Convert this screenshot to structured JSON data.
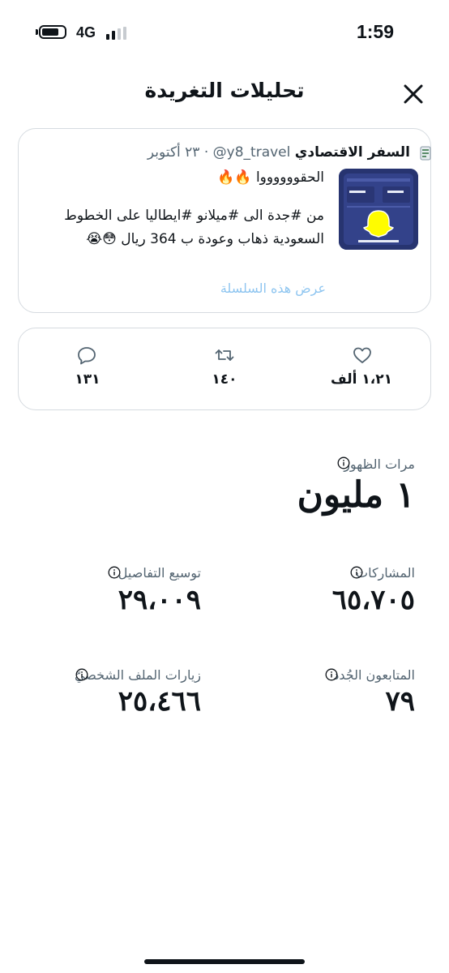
{
  "status_bar": {
    "time": "1:59",
    "network": "4G"
  },
  "header": {
    "title": "تحليلات التغريدة"
  },
  "tweet": {
    "author_name": "السفر الاقتصادي",
    "handle": "@y8_travel",
    "separator": "·",
    "date": "٢٣ أكتوبر",
    "text_lines": [
      "الحقووووووا 🔥🔥",
      "",
      "من #جدة الى #ميلانو #ايطاليا على الخطوط",
      "السعودية ذهاب وعودة ب 364 ريال 😳😭"
    ],
    "show_thread": "عرض هذه السلسلة"
  },
  "engagement": {
    "likes": "١،٢١ ألف",
    "retweets": "١٤٠",
    "replies": "١٣١"
  },
  "metrics": {
    "impressions": {
      "label": "مرات الظهور",
      "value": "١ مليون"
    },
    "engagements": {
      "label": "المشاركات",
      "value": "٦٥،٧٠٥"
    },
    "detail_expands": {
      "label": "توسيع التفاصيل",
      "value": "٢٩،٠٠٩"
    },
    "new_followers": {
      "label": "المتابعون الجُدد",
      "value": "٧٩"
    },
    "profile_visits": {
      "label": "زيارات الملف الشخصيّ",
      "value": "٢٥،٤٦٦"
    }
  },
  "colors": {
    "text": "#0f1419",
    "muted": "#536471",
    "border": "#d6dbe0",
    "link": "#8ec5f0"
  }
}
